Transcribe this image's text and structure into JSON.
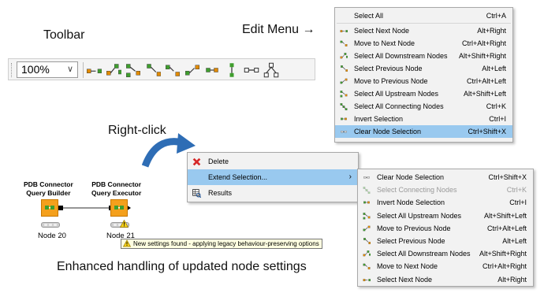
{
  "captions": {
    "toolbar": "Toolbar",
    "edit_menu": "Edit Menu →",
    "right_click": "Right-click",
    "bottom": "Enhanced handling of updated node settings"
  },
  "toolbar": {
    "zoom_value": "100%",
    "buttons": [
      "select-next-node-icon",
      "select-all-downstream-icon",
      "select-all-upstream-icon",
      "select-previous-node-icon",
      "move-to-next-node-icon",
      "move-to-previous-node-icon",
      "invert-selection-icon",
      "vertical-align-icon",
      "horizontal-align-icon",
      "tree-layout-icon"
    ]
  },
  "edit_menu": {
    "items": [
      {
        "label": "Select All",
        "shortcut": "Ctrl+A",
        "icon": "none"
      },
      {
        "label": "Select Next Node",
        "shortcut": "Alt+Right",
        "icon": "select-next-node-icon"
      },
      {
        "label": "Move to Next Node",
        "shortcut": "Ctrl+Alt+Right",
        "icon": "move-to-next-node-icon"
      },
      {
        "label": "Select All Downstream Nodes",
        "shortcut": "Alt+Shift+Right",
        "icon": "select-all-downstream-icon"
      },
      {
        "label": "Select Previous Node",
        "shortcut": "Alt+Left",
        "icon": "select-previous-node-icon"
      },
      {
        "label": "Move to Previous Node",
        "shortcut": "Ctrl+Alt+Left",
        "icon": "move-to-previous-node-icon"
      },
      {
        "label": "Select All Upstream Nodes",
        "shortcut": "Alt+Shift+Left",
        "icon": "select-all-upstream-icon"
      },
      {
        "label": "Select All Connecting Nodes",
        "shortcut": "Ctrl+K",
        "icon": "select-connecting-icon"
      },
      {
        "label": "Invert Selection",
        "shortcut": "Ctrl+I",
        "icon": "invert-selection-icon"
      },
      {
        "label": "Clear Node Selection",
        "shortcut": "Ctrl+Shift+X",
        "icon": "clear-selection-icon"
      }
    ]
  },
  "context_menu": {
    "items": [
      {
        "label": "Delete",
        "icon": "delete-icon"
      },
      {
        "label": "Extend Selection...",
        "icon": "none"
      },
      {
        "label": "Results",
        "icon": "results-icon"
      }
    ]
  },
  "submenu": {
    "items": [
      {
        "label": "Clear Node Selection",
        "shortcut": "Ctrl+Shift+X",
        "disabled": false
      },
      {
        "label": "Select Connecting Nodes",
        "shortcut": "Ctrl+K",
        "disabled": true
      },
      {
        "label": "Invert Node Selection",
        "shortcut": "Ctrl+I",
        "disabled": false
      },
      {
        "label": "Select All Upstream Nodes",
        "shortcut": "Alt+Shift+Left",
        "disabled": false
      },
      {
        "label": "Move to Previous Node",
        "shortcut": "Ctrl+Alt+Left",
        "disabled": false
      },
      {
        "label": "Select Previous Node",
        "shortcut": "Alt+Left",
        "disabled": false
      },
      {
        "label": "Select All Downstream Nodes",
        "shortcut": "Alt+Shift+Right",
        "disabled": false
      },
      {
        "label": "Move to Next Node",
        "shortcut": "Ctrl+Alt+Right",
        "disabled": false
      },
      {
        "label": "Select Next Node",
        "shortcut": "Alt+Right",
        "disabled": false
      }
    ]
  },
  "workflow": {
    "node1": {
      "title_line1": "PDB Connector",
      "title_line2": "Query Builder",
      "label": "Node 20"
    },
    "node2": {
      "title_line1": "PDB Connector",
      "title_line2": "Query Executor",
      "label": "Node 21"
    },
    "tooltip": "New settings found - applying legacy behaviour-preserving options"
  },
  "colors": {
    "highlight": "#99c9ef",
    "menu_bg": "#f2f2f2",
    "node_orange": "#f4a01c",
    "arrow_blue": "#2e6db5"
  }
}
